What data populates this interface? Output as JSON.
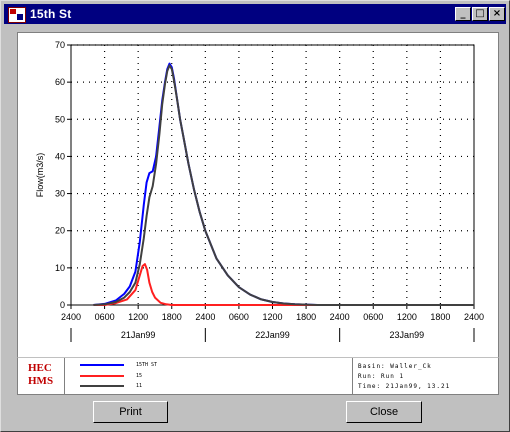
{
  "window": {
    "title": "15th St",
    "controls": {
      "minimize": "_",
      "maximize": "□",
      "close": "×"
    }
  },
  "chart_data": {
    "type": "line",
    "ylabel": "Flow(m3/s)",
    "ylim": [
      0,
      70
    ],
    "yticks": [
      0,
      10,
      20,
      30,
      40,
      50,
      60,
      70
    ],
    "xlim": [
      0,
      72
    ],
    "xticks_hours": [
      0,
      6,
      12,
      18,
      24,
      30,
      36,
      42,
      48,
      54,
      60,
      66,
      72
    ],
    "xtick_labels": [
      "2400",
      "0600",
      "1200",
      "1800",
      "2400",
      "0600",
      "1200",
      "1800",
      "2400",
      "0600",
      "1200",
      "1800",
      "2400"
    ],
    "date_labels": [
      "21Jan99",
      "22Jan99",
      "23Jan99"
    ],
    "grid": true,
    "series": [
      {
        "name": "15TH ST",
        "color": "#0000ff",
        "x": [
          4,
          6,
          8,
          9.5,
          10.5,
          11.5,
          12.3,
          13,
          13.5,
          14,
          14.6,
          15.2,
          15.8,
          16.3,
          16.8,
          17.2,
          17.6,
          18,
          18.4,
          19,
          19.5,
          20,
          21,
          22,
          23,
          24,
          26,
          28,
          30,
          32,
          34,
          36,
          38,
          40,
          44,
          72
        ],
        "y": [
          0,
          0.3,
          1.2,
          3,
          5,
          9,
          17,
          27,
          33,
          35.5,
          36,
          40,
          48,
          55,
          60,
          63.5,
          65,
          64,
          61,
          55,
          50,
          46,
          38,
          31,
          25,
          20,
          12.5,
          8,
          4.8,
          2.8,
          1.5,
          0.8,
          0.4,
          0.2,
          0,
          0
        ]
      },
      {
        "name": "15",
        "color": "#ff2020",
        "x": [
          4,
          6,
          8,
          10,
          11.5,
          12.3,
          12.8,
          13.2,
          13.6,
          14,
          14.5,
          15,
          16,
          17,
          18,
          20,
          72
        ],
        "y": [
          0,
          0,
          0.5,
          1.5,
          4,
          8,
          10.5,
          11,
          9.5,
          6,
          3.5,
          2,
          0.6,
          0.2,
          0,
          0,
          0
        ]
      },
      {
        "name": "11",
        "color": "#404040",
        "x": [
          4,
          6,
          8,
          9.5,
          10.5,
          11.5,
          12.3,
          13,
          13.5,
          14,
          14.6,
          15.2,
          15.8,
          16.3,
          16.8,
          17.2,
          17.6,
          18,
          18.4,
          19,
          19.5,
          20,
          21,
          22,
          23,
          24,
          26,
          28,
          30,
          32,
          34,
          36,
          38,
          40,
          44,
          72
        ],
        "y": [
          0,
          0.2,
          0.8,
          2,
          3.5,
          6,
          11,
          18,
          24,
          29,
          32,
          38,
          46,
          54,
          59.5,
          63,
          64.5,
          63.5,
          60.5,
          55,
          50,
          46,
          38,
          31,
          25,
          20,
          12.5,
          8,
          4.8,
          2.8,
          1.5,
          0.8,
          0.4,
          0.2,
          0,
          0
        ]
      }
    ]
  },
  "legend": {
    "logo_line1": "HEC",
    "logo_line2": "HMS",
    "items": [
      {
        "label": "15TH ST",
        "color": "#0000ff"
      },
      {
        "label": "15",
        "color": "#ff2020"
      },
      {
        "label": "11",
        "color": "#404040"
      }
    ],
    "info": {
      "basin": "Basin: Waller_Ck",
      "run": "Run:  Run 1",
      "time": "Time:  21Jan99, 13.21"
    }
  },
  "buttons": {
    "print": "Print",
    "close": "Close"
  }
}
